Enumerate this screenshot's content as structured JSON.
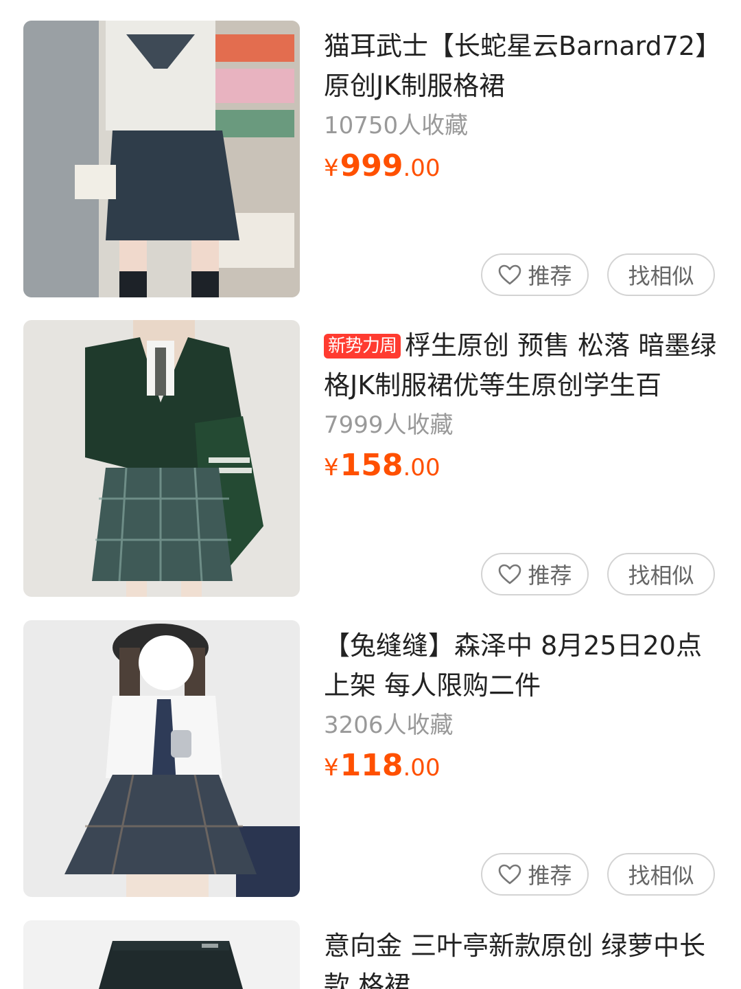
{
  "items": [
    {
      "badge": "",
      "title": "猫耳武士【长蛇星云Barnard72】 原创JK制服格裙",
      "favorites": "10750人收藏",
      "price": {
        "currency": "¥",
        "integer": "999",
        "decimal": ".00"
      },
      "recommend_label": "推荐",
      "similar_label": "找相似"
    },
    {
      "badge": "新势力周",
      "title": "桴生原创 预售 松落 暗墨绿格JK制服裙优等生原创学生百",
      "favorites": "7999人收藏",
      "price": {
        "currency": "¥",
        "integer": "158",
        "decimal": ".00"
      },
      "recommend_label": "推荐",
      "similar_label": "找相似"
    },
    {
      "badge": "",
      "title": "【兔缝缝】森泽中 8月25日20点上架 每人限购二件",
      "favorites": "3206人收藏",
      "price": {
        "currency": "¥",
        "integer": "118",
        "decimal": ".00"
      },
      "recommend_label": "推荐",
      "similar_label": "找相似"
    },
    {
      "badge": "",
      "title": "意向金 三叶亭新款原创 绿萝中长款 格裙",
      "favorites": "",
      "price": {
        "currency": "",
        "integer": "",
        "decimal": ""
      },
      "recommend_label": "",
      "similar_label": ""
    }
  ],
  "colors": {
    "price": "#ff5000",
    "badge": "#ff3b30",
    "muted": "#999999"
  },
  "icons": {
    "recommend": "heart-outline-icon"
  }
}
